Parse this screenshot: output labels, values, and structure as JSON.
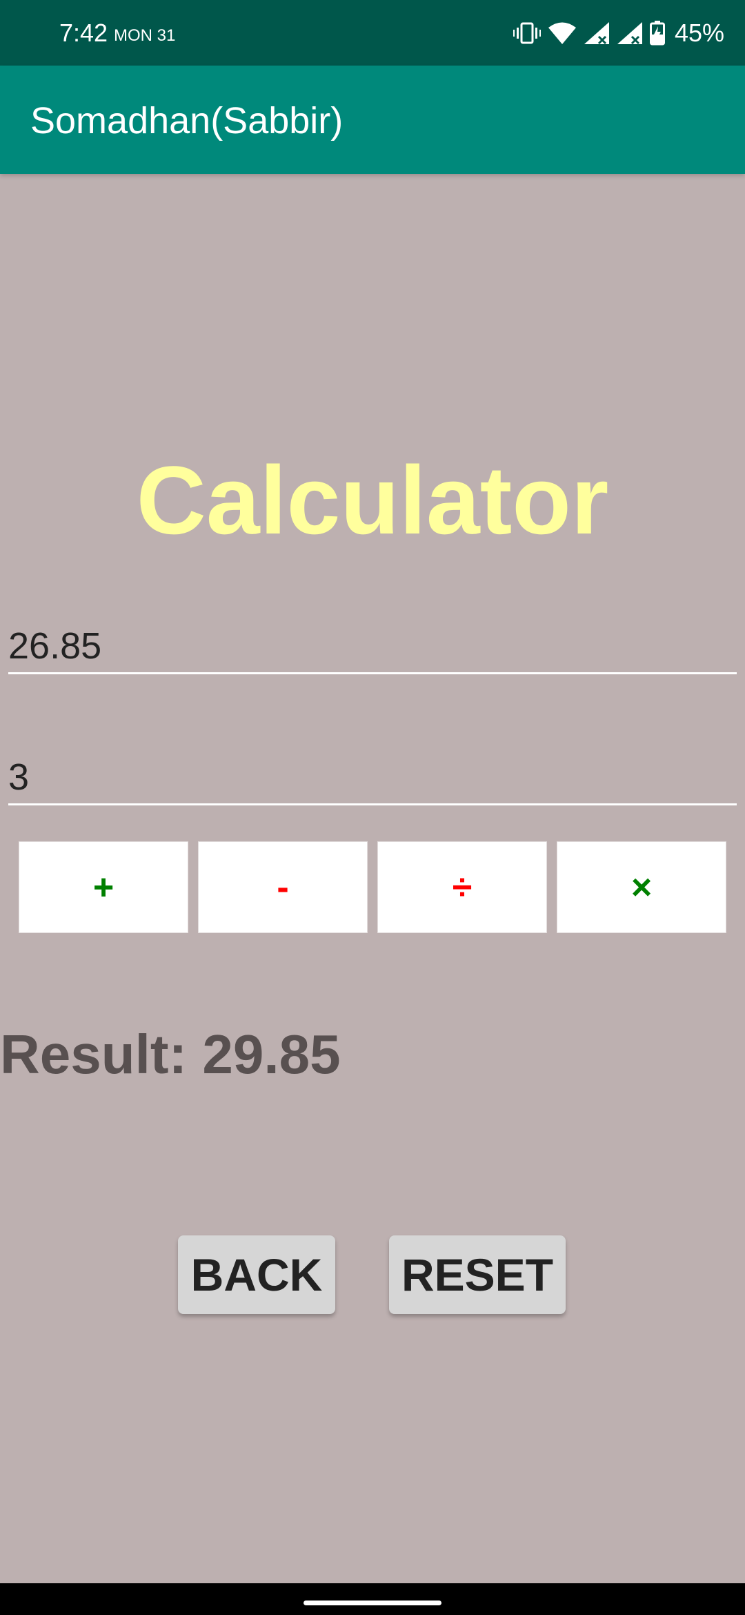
{
  "status_bar": {
    "time": "7:42",
    "date": "MON 31",
    "battery": "45%",
    "icons": [
      "vibrate-icon",
      "wifi-icon",
      "signal-icon",
      "signal-icon",
      "battery-charging-icon"
    ]
  },
  "app_bar": {
    "title": "Somadhan(Sabbir)"
  },
  "main": {
    "heading": "Calculator",
    "input_1": "26.85",
    "input_2": "3",
    "operators": {
      "add": "+",
      "subtract": "-",
      "divide": "÷",
      "multiply": "×"
    },
    "result": "Result: 29.85",
    "back_label": "BACK",
    "reset_label": "RESET"
  },
  "colors": {
    "status_bar": "#00574b",
    "app_bar": "#00897b",
    "background": "#bdb0b0",
    "heading": "#ffff9d",
    "result_text": "#585050",
    "op_green": "#008000",
    "op_red": "#ff0000"
  }
}
